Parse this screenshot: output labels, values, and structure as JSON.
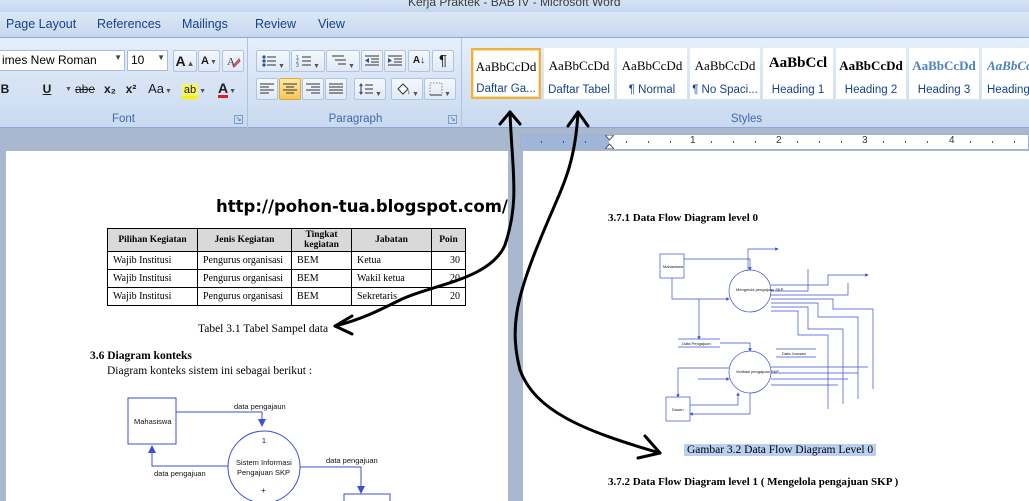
{
  "window": {
    "title": "Kerja Praktek - BAB IV - Microsoft Word"
  },
  "tabs": [
    "Page Layout",
    "References",
    "Mailings",
    "Review",
    "View"
  ],
  "font_group": {
    "font_name": "imes New Roman",
    "font_size": "10",
    "grow_label": "A",
    "shrink_label": "A",
    "bold": "B",
    "underline": "U",
    "strike": "abe",
    "subscript": "x₂",
    "superscript": "x²",
    "change_case": "Aa",
    "highlight": "ab",
    "font_color": "A",
    "label": "Font"
  },
  "paragraph_group": {
    "label": "Paragraph",
    "sort_label": "A↓",
    "pilcrow": "¶"
  },
  "styles_group": {
    "label": "Styles",
    "gallery": [
      {
        "preview": "AaBbCcDd",
        "name": "Daftar Ga...",
        "selected": true
      },
      {
        "preview": "AaBbCcDd",
        "name": "Daftar Tabel"
      },
      {
        "preview": "AaBbCcDd",
        "name": "¶ Normal"
      },
      {
        "preview": "AaBbCcDd",
        "name": "¶ No Spaci..."
      },
      {
        "preview": "AaBbCcl",
        "name": "Heading 1"
      },
      {
        "preview": "AaBbCcDd",
        "name": "Heading 2"
      },
      {
        "preview": "AaBbCcDd",
        "name": "Heading 3"
      },
      {
        "preview": "AaBbCcDd",
        "name": "Heading"
      }
    ]
  },
  "ruler": {
    "numbers": [
      "1",
      "2",
      "3",
      "4"
    ]
  },
  "left_page": {
    "url": "http://pohon-tua.blogspot.com/",
    "table": {
      "headers": [
        "Pilihan Kegiatan",
        "Jenis Kegiatan",
        "Tingkat kegiatan",
        "Jabatan",
        "Poin"
      ],
      "rows": [
        [
          "Wajib Institusi",
          "Pengurus organisasi",
          "BEM",
          "Ketua",
          "30"
        ],
        [
          "Wajib Institusi",
          "Pengurus organisasi",
          "BEM",
          "Wakil ketua",
          "20"
        ],
        [
          "Wajib Institusi",
          "Pengurus organisasi",
          "BEM",
          "Sekretaris",
          "20"
        ]
      ]
    },
    "table_caption": "Tabel 3.1 Tabel Sampel data",
    "section_heading": "3.6 Diagram konteks",
    "section_text": "Diagram konteks sistem ini sebagai berikut :",
    "context_diagram": {
      "entity": "Mahasiswa",
      "process_number": "1",
      "process_label_1": "Sistem Informasi",
      "process_label_2": "Pengajuan SKP",
      "flow_in": "data pengajaun",
      "flow_out": "data pengajuan",
      "flow_right": "data pengajuan"
    }
  },
  "right_page": {
    "heading_level0": "3.7.1 Data Flow Diagram level 0",
    "figure_caption": "Gambar 3.2 Data Flow Diagram Level  0",
    "heading_level1": "3.7.2 Data Flow Diagram level 1 ( Mengelola pengajuan SKP )",
    "dfd0": {
      "entity_top": "Mahasiswa",
      "entity_bottom": "Dosen",
      "process_1": "Mengelola pengajuan SKP",
      "process_2": "Verikasi pengajuan SKP",
      "store_1": "Data Pengajuan",
      "store_2": "Data Jurusan"
    }
  },
  "colors": {
    "ribbon_text": "#15428b",
    "selected_style_border": "#f2b13b",
    "diagram_blue": "#3b4fd1",
    "caption_highlight": "#b9d0f0"
  }
}
